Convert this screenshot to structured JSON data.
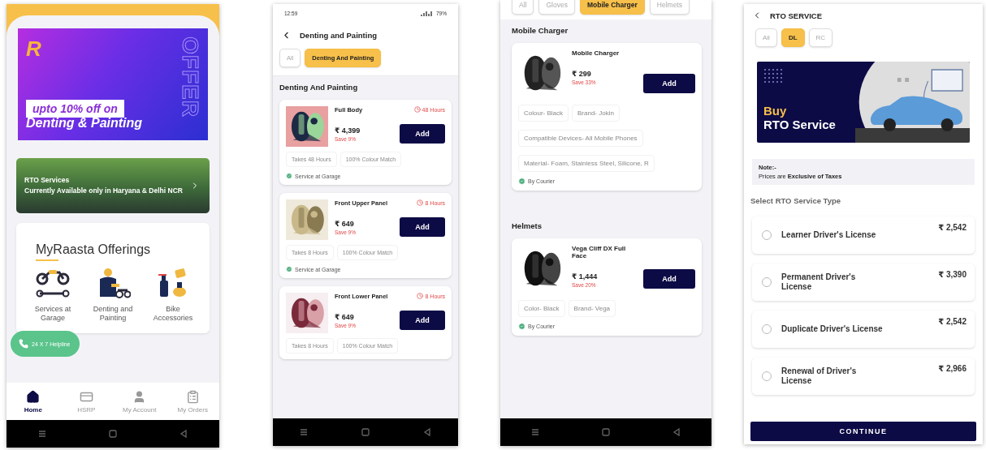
{
  "home_screen": {
    "banner": {
      "logo": "R",
      "headline": "upto 10% off on",
      "subline": "Denting & Painting",
      "side_text": "OFFER"
    },
    "rto_banner": {
      "title": "RTO Services",
      "text": "Currently Available only in Haryana & Delhi NCR"
    },
    "offerings": {
      "title": "MyRaasta Offerings",
      "items": [
        {
          "kind": "garage",
          "label": "Services at Garage"
        },
        {
          "kind": "painting",
          "label": "Denting and Painting"
        },
        {
          "kind": "accessories",
          "label": "Bike Accessories"
        }
      ]
    },
    "helpline": "24 X 7 Helpline",
    "nav": [
      {
        "kind": "home",
        "label": "Home",
        "selected": true
      },
      {
        "kind": "plate",
        "label": "HSRP",
        "selected": false
      },
      {
        "kind": "account",
        "label": "My Account",
        "selected": false
      },
      {
        "kind": "orders",
        "label": "My Orders",
        "selected": false
      }
    ]
  },
  "denting_screen": {
    "status": {
      "time": "12:59",
      "battery": "79%"
    },
    "title": "Denting and Painting",
    "chips": [
      {
        "label": "All",
        "selected": false
      },
      {
        "label": "Denting And Painting",
        "selected": true
      }
    ],
    "section": "Denting And Painting",
    "products": [
      {
        "name": "Full Body",
        "duration": "48 Hours",
        "price": "₹ 4,399",
        "save": "Save 9%",
        "button": "Add",
        "features": [
          "Takes 48 Hours",
          "100% Colour Match"
        ],
        "delivery": "Service at Garage"
      },
      {
        "name": "Front Upper Panel",
        "duration": "8 Hours",
        "price": "₹ 649",
        "save": "Save 9%",
        "button": "Add",
        "features": [
          "Takes 8 Hours",
          "100% Colour Match"
        ],
        "delivery": "Service at Garage"
      },
      {
        "name": "Front Lower Panel",
        "duration": "8 Hours",
        "price": "₹ 649",
        "save": "Save 9%",
        "button": "Add",
        "features": [
          "Takes 8 Hours",
          "100% Colour Match"
        ]
      }
    ]
  },
  "accessories_screen": {
    "chips": [
      {
        "label": "All",
        "selected": false
      },
      {
        "label": "Gloves",
        "selected": false
      },
      {
        "label": "Mobile Charger",
        "selected": true
      },
      {
        "label": "Helmets",
        "selected": false
      }
    ],
    "sections": [
      {
        "title": "Mobile Charger",
        "products": [
          {
            "name": "Mobile Charger",
            "price": "₹ 299",
            "save": "Save 33%",
            "button": "Add",
            "features": [
              [
                "Colour- Black",
                "Brand- Jokin"
              ],
              [
                "Compatible Devices- All Mobile Phones"
              ],
              [
                "Material- Foam, Stainless Steel, Silicone, R"
              ]
            ],
            "delivery": "By Courier"
          }
        ]
      },
      {
        "title": "Helmets",
        "products": [
          {
            "name": "Vega Cliff DX Full Face",
            "price": "₹ 1,444",
            "save": "Save 20%",
            "button": "Add",
            "features": [
              [
                "Color- Black",
                "Brand- Vega"
              ]
            ],
            "delivery": "By Courier"
          }
        ]
      }
    ]
  },
  "rto_screen": {
    "title": "RTO SERVICE",
    "chips": [
      {
        "label": "All",
        "selected": false
      },
      {
        "label": "DL",
        "selected": true
      },
      {
        "label": "RC",
        "selected": false
      }
    ],
    "banner": {
      "accent": "Buy",
      "title": "RTO Service"
    },
    "note": {
      "label": "Note:-",
      "text": "Prices are **Exclusive of Taxes**"
    },
    "prompt": "Select RTO Service Type",
    "options": [
      {
        "label": "Learner Driver's License",
        "price": "₹ 2,542",
        "selected": false
      },
      {
        "label": "Permanent Driver's License",
        "price": "₹ 3,390",
        "selected": false
      },
      {
        "label": "Duplicate Driver's License",
        "price": "₹ 2,542",
        "selected": false
      },
      {
        "label": "Renewal of Driver's License",
        "price": "₹ 2,966",
        "selected": false
      }
    ],
    "button": "CONTINUE"
  }
}
